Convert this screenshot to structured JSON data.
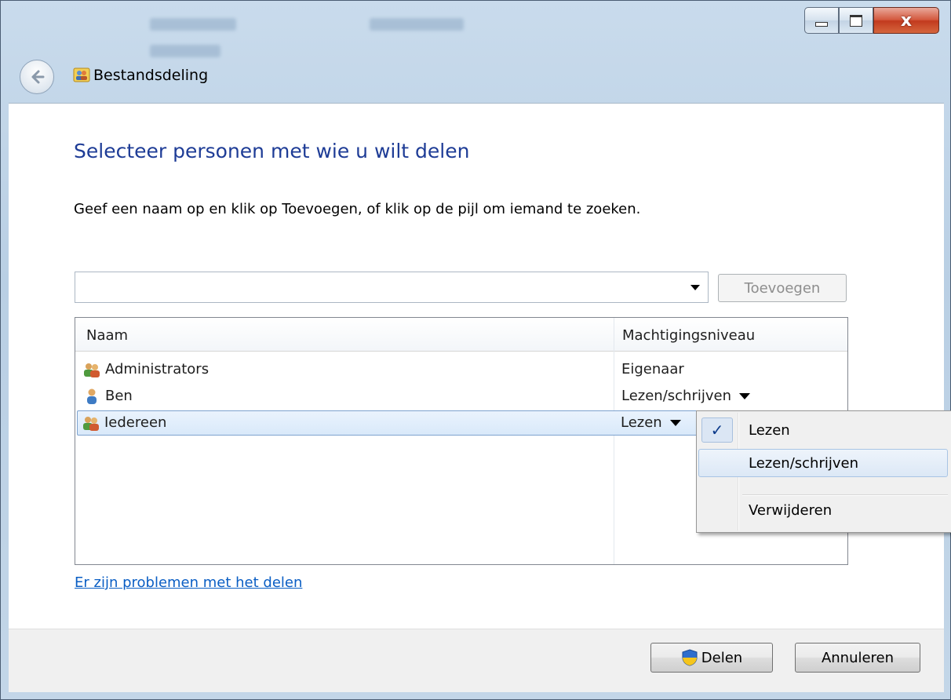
{
  "window": {
    "title": "Bestandsdeling",
    "controls": {
      "minimize": "minimize",
      "maximize": "maximize",
      "close": "x"
    }
  },
  "main": {
    "heading": "Selecteer personen met wie u wilt delen",
    "instruction": "Geef een naam op en klik op Toevoegen, of klik op de pijl om iemand te zoeken.",
    "name_input": {
      "value": "",
      "placeholder": ""
    },
    "add_button": "Toevoegen",
    "list": {
      "columns": [
        "Naam",
        "Machtigingsniveau"
      ],
      "rows": [
        {
          "name": "Administrators",
          "level": "Eigenaar",
          "icon": "group-icon"
        },
        {
          "name": "Ben",
          "level": "Lezen/schrijven",
          "icon": "user-icon"
        },
        {
          "name": "Iedereen",
          "level": "Lezen",
          "icon": "group-icon"
        }
      ]
    },
    "problems_link": "Er zijn problemen met het delen"
  },
  "permission_menu": {
    "items": [
      {
        "label": "Lezen",
        "checked": true
      },
      {
        "label": "Lezen/schrijven",
        "checked": false
      },
      {
        "label": "Verwijderen",
        "checked": false
      }
    ]
  },
  "footer": {
    "share_button": "Delen",
    "cancel_button": "Annuleren"
  },
  "colors": {
    "heading": "#1e3c96",
    "link": "#0a5ec4",
    "selection": "#d9e9fa",
    "close_button": "#c23a1e"
  }
}
